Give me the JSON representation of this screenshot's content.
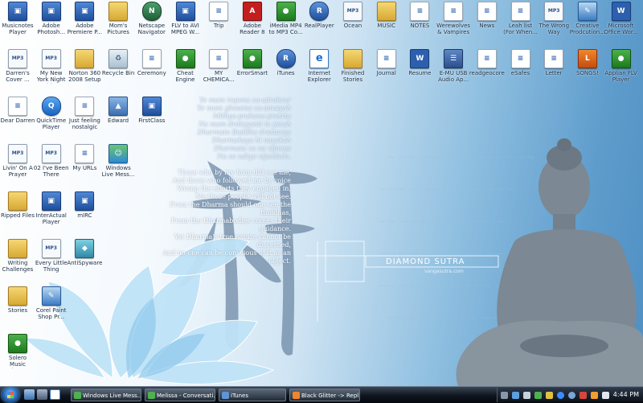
{
  "desktop": {
    "icons": [
      {
        "label": "Musicnotes Player",
        "glyph": "t-app",
        "col": 0,
        "row": 0
      },
      {
        "label": "Adobe Photosh...",
        "glyph": "t-app",
        "col": 1,
        "row": 0
      },
      {
        "label": "Adobe Premiere P...",
        "glyph": "t-app",
        "col": 2,
        "row": 0
      },
      {
        "label": "Mom's Pictures",
        "glyph": "t-folder",
        "col": 3,
        "row": 0
      },
      {
        "label": "Netscape Navigator",
        "glyph": "t-nav",
        "col": 4,
        "row": 0
      },
      {
        "label": "FLV to AVI MPEG W...",
        "glyph": "t-app",
        "col": 5,
        "row": 0
      },
      {
        "label": "Trip",
        "glyph": "t-doc",
        "col": 6,
        "row": 0
      },
      {
        "label": "Adobe Reader 8",
        "glyph": "t-pdf",
        "col": 7,
        "row": 0
      },
      {
        "label": "iMedia MP4 to MP3 Co...",
        "glyph": "t-green",
        "col": 8,
        "row": 0
      },
      {
        "label": "RealPlayer",
        "glyph": "t-real",
        "col": 9,
        "row": 0
      },
      {
        "label": "Ocean",
        "glyph": "t-mp3",
        "col": 10,
        "row": 0
      },
      {
        "label": "MUSIC",
        "glyph": "t-folder",
        "col": 11,
        "row": 0
      },
      {
        "label": "NOTES",
        "glyph": "t-doc",
        "col": 12,
        "row": 0
      },
      {
        "label": "Werewolves & Vampires",
        "glyph": "t-doc",
        "col": 13,
        "row": 0
      },
      {
        "label": "News",
        "glyph": "t-doc",
        "col": 14,
        "row": 0
      },
      {
        "label": "Leah list (For When...",
        "glyph": "t-doc",
        "col": 15,
        "row": 0
      },
      {
        "label": "The Wrong Way",
        "glyph": "t-mp3",
        "col": 16,
        "row": 0
      },
      {
        "label": "Creative Prodcution...",
        "glyph": "t-paint",
        "col": 17,
        "row": 0
      },
      {
        "label": "Microsoft Office Wor...",
        "glyph": "t-word",
        "col": 18,
        "row": 0
      },
      {
        "label": "Darren's Cover ...",
        "glyph": "t-mp3",
        "col": 0,
        "row": 1
      },
      {
        "label": "My New York Night With ...",
        "glyph": "t-mp3",
        "col": 1,
        "row": 1
      },
      {
        "label": "Norton 360 2008 Setup",
        "glyph": "t-folder",
        "col": 2,
        "row": 1
      },
      {
        "label": "Recycle Bin",
        "glyph": "t-recycle",
        "col": 3,
        "row": 1
      },
      {
        "label": "Ceremony",
        "glyph": "t-doc",
        "col": 4,
        "row": 1
      },
      {
        "label": "Cheat Engine",
        "glyph": "t-green",
        "col": 5,
        "row": 1
      },
      {
        "label": "MY CHEMICA...",
        "glyph": "t-doc",
        "col": 6,
        "row": 1
      },
      {
        "label": "ErrorSmart",
        "glyph": "t-green",
        "col": 7,
        "row": 1
      },
      {
        "label": "iTunes",
        "glyph": "t-real",
        "col": 8,
        "row": 1
      },
      {
        "label": "Internet Explorer",
        "glyph": "t-ie",
        "col": 9,
        "row": 1
      },
      {
        "label": "Finished Stories",
        "glyph": "t-folder",
        "col": 10,
        "row": 1
      },
      {
        "label": "Journal",
        "glyph": "t-doc",
        "col": 11,
        "row": 1
      },
      {
        "label": "Resume",
        "glyph": "t-word",
        "col": 12,
        "row": 1
      },
      {
        "label": "E-MU USB Audio Ap...",
        "glyph": "t-stack",
        "col": 13,
        "row": 1
      },
      {
        "label": "readgeocore",
        "glyph": "t-doc",
        "col": 14,
        "row": 1
      },
      {
        "label": "eSafes",
        "glyph": "t-doc",
        "col": 15,
        "row": 1
      },
      {
        "label": "Letter",
        "glyph": "t-doc",
        "col": 16,
        "row": 1
      },
      {
        "label": "SONGS! ",
        "glyph": "t-orange",
        "col": 17,
        "row": 1
      },
      {
        "label": "Applian FLV Player",
        "glyph": "t-green",
        "col": 18,
        "row": 1
      },
      {
        "label": "Dear Darren",
        "glyph": "t-doc",
        "col": 0,
        "row": 2
      },
      {
        "label": "QuickTime Player",
        "glyph": "t-quick",
        "col": 1,
        "row": 2
      },
      {
        "label": "Just feeling nostalgic",
        "glyph": "t-doc",
        "col": 2,
        "row": 2
      },
      {
        "label": "Edward",
        "glyph": "t-edward",
        "col": 3,
        "row": 2
      },
      {
        "label": "FirstClass",
        "glyph": "t-app",
        "col": 4,
        "row": 2
      },
      {
        "label": "Livin' On A Prayer",
        "glyph": "t-mp3",
        "col": 0,
        "row": 3
      },
      {
        "label": "02 I've Been There",
        "glyph": "t-mp3",
        "col": 1,
        "row": 3
      },
      {
        "label": "My URLs",
        "glyph": "t-doc",
        "col": 2,
        "row": 3
      },
      {
        "label": "Windows Live Mess...",
        "glyph": "t-people",
        "col": 3,
        "row": 3
      },
      {
        "label": "Ripped Files",
        "glyph": "t-folder",
        "col": 0,
        "row": 4
      },
      {
        "label": "InterActual Player",
        "glyph": "t-app",
        "col": 1,
        "row": 4
      },
      {
        "label": "mIRC",
        "glyph": "t-app",
        "col": 2,
        "row": 4
      },
      {
        "label": "Writing Challenges",
        "glyph": "t-folder",
        "col": 0,
        "row": 5
      },
      {
        "label": "Every Little Thing",
        "glyph": "t-mp3",
        "col": 1,
        "row": 5
      },
      {
        "label": "AntiSpyware",
        "glyph": "t-shield",
        "col": 2,
        "row": 5
      },
      {
        "label": "Stories",
        "glyph": "t-folder",
        "col": 0,
        "row": 6
      },
      {
        "label": "Corel Paint Shop Pr...",
        "glyph": "t-paint",
        "col": 1,
        "row": 6
      },
      {
        "label": "Solero Music Viewer",
        "glyph": "t-green",
        "col": 0,
        "row": 7
      }
    ]
  },
  "wallpaper": {
    "sanskrit_lines": [
      "Ye mam rupena ca-adraksur",
      "Ye mam ghosena ca-anvayuh",
      "Mithya-prahana-prasrta",
      "Na mam draksyanti te janah",
      "Dharmato Buddha drastavya",
      "Dharmakaya hi nayakah",
      "Dharmata ca na vijneya",
      "Na sa sakya vijanitum."
    ],
    "english_lines": [
      "Those who by my form did see me,",
      "And those who followed me by voice",
      "Wrong the efforts they engaged in,",
      "Me those people will not see.",
      "From the Dharma should one see the Buddhas,",
      "From the Dharmabodies comes their guidance.",
      "Yet Dharma's true nature cannot be discerned,",
      "And no one can be conscious of it as an object."
    ],
    "title": "DIAMOND SUTRA",
    "subtitle": "vangasutra.com",
    "colors": {
      "lotus": "#bfe3f7",
      "statue": "#7c8893",
      "calligraphy": "#6f8aa6"
    }
  },
  "taskbar": {
    "tasks": [
      {
        "label": "Windows Live Mess...",
        "icon_color": "#4fb04f"
      },
      {
        "label": "Melissa - Conversati...",
        "icon_color": "#4fb04f"
      },
      {
        "label": "iTunes",
        "icon_color": "#5e93d8"
      },
      {
        "label": "Black Glitter -> Repl...",
        "icon_color": "#f1852b"
      }
    ],
    "clock": "4:44 PM"
  }
}
